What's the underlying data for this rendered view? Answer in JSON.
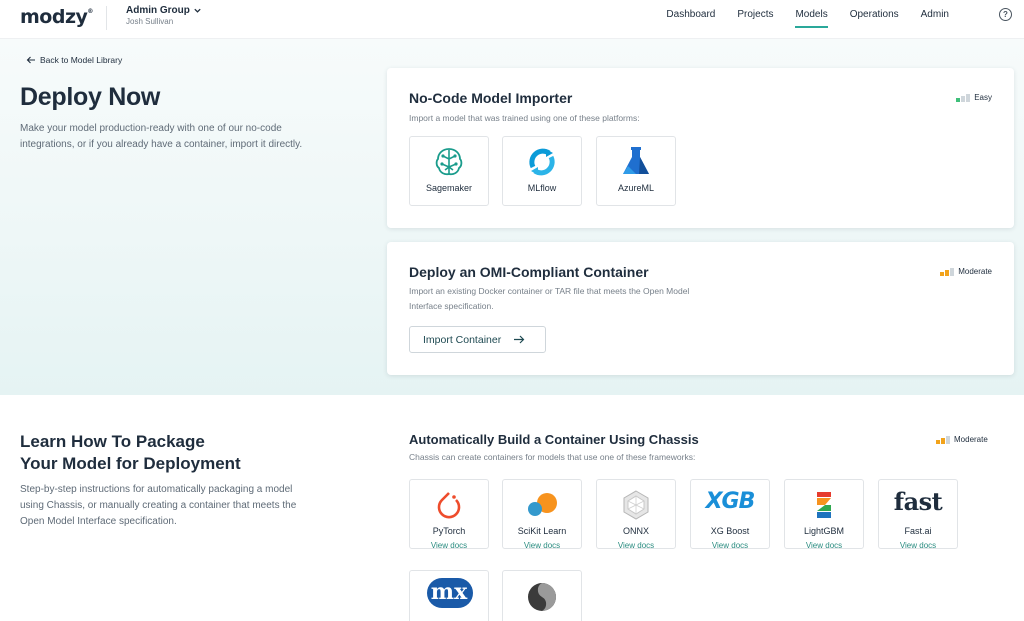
{
  "app": {
    "logo": "modzy",
    "logo_mark": "®"
  },
  "org": {
    "name": "Admin Group",
    "user": "Josh Sullivan"
  },
  "nav": {
    "items": [
      "Dashboard",
      "Projects",
      "Models",
      "Operations",
      "Admin"
    ],
    "active": "Models",
    "help": "?"
  },
  "hero": {
    "back_link": "Back to Model Library",
    "title": "Deploy Now",
    "description": "Make your model production-ready with one of our no-code integrations, or if you already have a container, import it directly."
  },
  "importer": {
    "title": "No-Code Model Importer",
    "subtitle": "Import a model that was trained using one of these platforms:",
    "difficulty": "Easy",
    "platforms": [
      "Sagemaker",
      "MLflow",
      "AzureML"
    ]
  },
  "container": {
    "title": "Deploy an OMI-Compliant Container",
    "subtitle_line1": "Import an existing Docker container or TAR file that meets the Open Model",
    "subtitle_line2": "Interface specification.",
    "difficulty": "Moderate",
    "button": "Import Container"
  },
  "learn": {
    "title_line1": "Learn How To Package",
    "title_line2": "Your Model for Deployment",
    "description": "Step-by-step instructions for automatically packaging a model using Chassis, or manually creating a container that meets the Open Model Interface specification."
  },
  "chassis": {
    "title": "Automatically Build a Container Using Chassis",
    "subtitle": "Chassis can create containers for models that use one of these frameworks:",
    "difficulty": "Moderate",
    "frameworks": [
      {
        "name": "PyTorch",
        "docs": "View docs"
      },
      {
        "name": "SciKit Learn",
        "docs": "View docs"
      },
      {
        "name": "ONNX",
        "docs": "View docs"
      },
      {
        "name": "XG Boost",
        "docs": "View docs"
      },
      {
        "name": "LightGBM",
        "docs": "View docs"
      },
      {
        "name": "Fast.ai",
        "docs": "View docs"
      }
    ],
    "logo_text": {
      "xgb": "XGB",
      "fast": "fast",
      "mx": "mx"
    }
  },
  "colors": {
    "accent": "#2aa89a",
    "text": "#1f2d3d",
    "muted": "#5f6b77",
    "link": "#2a8c80",
    "easy_bar": "#3fbf7a",
    "moderate_bar": "#f2a31b"
  }
}
